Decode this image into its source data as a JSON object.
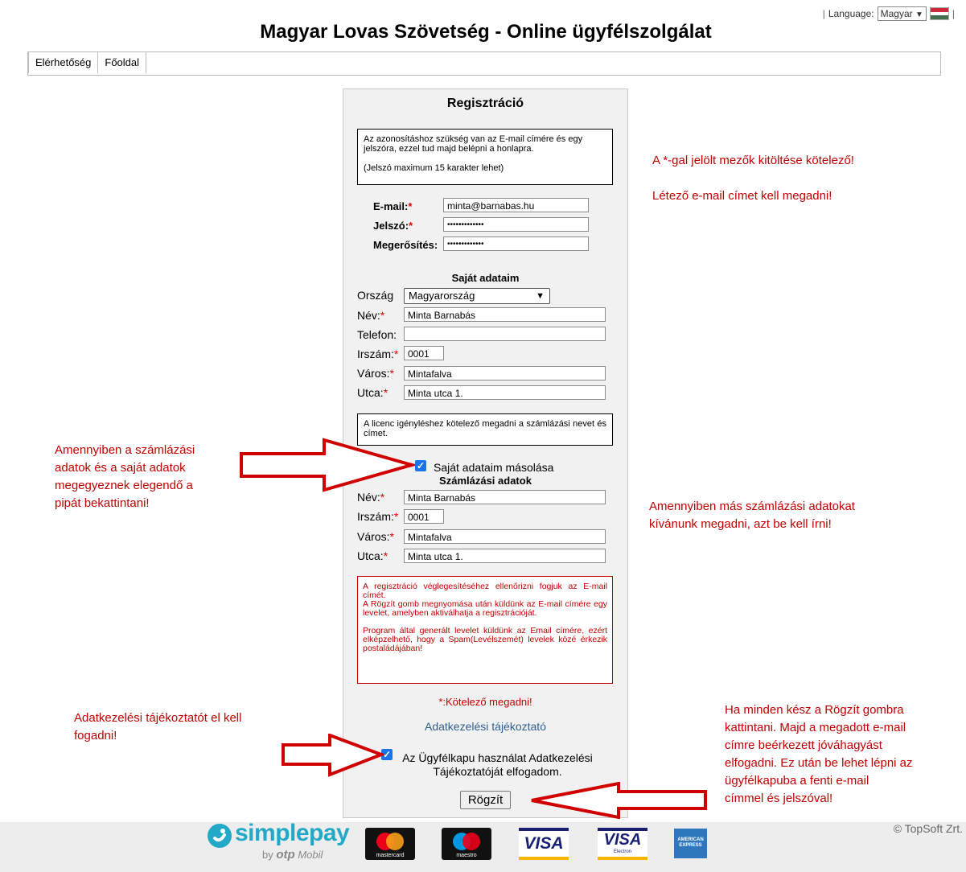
{
  "header": {
    "language_label": "Language:",
    "language_value": "Magyar",
    "site_title": "Magyar Lovas Szövetség - Online ügyfélszolgálat",
    "nav": [
      "Elérhetőség",
      "Főoldal"
    ]
  },
  "form": {
    "title": "Regisztráció",
    "intro_text": "Az azonosításhoz szükség van az E-mail címére és egy jelszóra, ezzel tud majd belépni a honlapra.",
    "intro_note": "(Jelszó maximum 15 karakter lehet)",
    "email_label": "E-mail:",
    "email_value": "minta@barnabas.hu",
    "password_label": "Jelszó:",
    "password_value": "•••••••••••••",
    "confirm_label": "Megerősítés:",
    "confirm_value": "•••••••••••••",
    "required_star": "*",
    "own_data_title": "Saját adataim",
    "country_label": "Ország",
    "country_value": "Magyarország",
    "name_label": "Név:",
    "name_value": "Minta Barnabás",
    "phone_label": "Telefon:",
    "phone_value": "",
    "zip_label": "Irszám:",
    "zip_value": "0001",
    "city_label": "Város:",
    "city_value": "Mintafalva",
    "street_label": "Utca:",
    "street_value": "Minta utca 1.",
    "license_note": "A licenc igényléshez kötelező megadni a számlázási nevet és címet.",
    "copy_checkbox_label": "Saját adataim másolása",
    "billing_title": "Számlázási adatok",
    "billing_name_value": "Minta Barnabás",
    "billing_zip_value": "0001",
    "billing_city_value": "Mintafalva",
    "billing_street_value": "Minta utca 1.",
    "warning_p1": "A regisztráció véglegesítéséhez ellenőrizni fogjuk az E-mail címét.",
    "warning_p2": "A Rögzít gomb megnyomása után küldünk az E-mail címére egy levelet, amelyben aktiválhatja a regisztrációját.",
    "warning_p3": "Program által generált levelet küldünk az Email címére, ezért elképzelhető, hogy a Spam(Levélszemét) levelek közé érkezik postaládájában!",
    "required_note": "*:Kötelező megadni!",
    "privacy_link": "Adatkezelési tájékoztató",
    "accept_label_line1": "Az Ügyfélkapu használat Adatkezelési",
    "accept_label_line2": "Tájékoztatóját elfogadom.",
    "submit_label": "Rögzít",
    "checkmark": "✓"
  },
  "annotations": {
    "required_fields": "A *-gal jelölt mezők kitöltése kötelező!",
    "existing_email": "Létező e-mail címet kell megadni!",
    "copy_hint": [
      "Amennyiben a számlázási",
      "adatok és a saját adatok",
      "megegyeznek elegendő a",
      "pipát bekattintani!"
    ],
    "other_billing": [
      "Amennyiben más számlázási adatokat",
      "kívánunk megadni, azt be kell írni!"
    ],
    "privacy_hint": [
      "Adatkezelési tájékoztatót el kell",
      "fogadni!"
    ],
    "submit_hint": [
      "Ha minden kész a Rögzít gombra",
      "kattintani. Majd a megadott e-mail",
      "címre beérkezett jóváhagyást",
      "elfogadni. Ez után be lehet lépni az",
      "ügyfélkapuba a fenti e-mail",
      "címmel és jelszóval!"
    ]
  },
  "footer": {
    "simplepay": "simplepay",
    "simplepay_by": "by",
    "otp": "otp",
    "otp_mobil": "Mobil",
    "mastercard": "mastercard",
    "maestro": "maestro",
    "visa": "VISA",
    "visa_electron_sub": "Electron",
    "amex": "AMERICAN EXPRESS",
    "copyright": "© TopSoft Zrt."
  },
  "colors": {
    "annotation_red": "#c00000",
    "checkbox_blue": "#1a73e8",
    "link_blue": "#2f5f8f"
  }
}
